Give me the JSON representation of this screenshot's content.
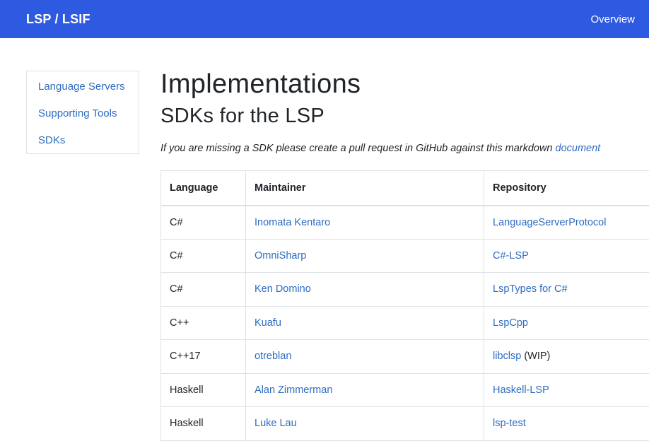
{
  "navbar": {
    "brand": "LSP / LSIF",
    "overview": "Overview"
  },
  "sidebar": {
    "items": [
      {
        "label": "Language Servers"
      },
      {
        "label": "Supporting Tools"
      },
      {
        "label": "SDKs"
      }
    ]
  },
  "main": {
    "title": "Implementations",
    "subtitle": "SDKs for the LSP",
    "note_text": "If you are missing a SDK please create a pull request in GitHub against this markdown ",
    "note_link": "document"
  },
  "table": {
    "headers": [
      "Language",
      "Maintainer",
      "Repository"
    ],
    "rows": [
      {
        "language": "C#",
        "maintainer": "Inomata Kentaro",
        "repository": "LanguageServerProtocol",
        "suffix": ""
      },
      {
        "language": "C#",
        "maintainer": "OmniSharp",
        "repository": "C#-LSP",
        "suffix": ""
      },
      {
        "language": "C#",
        "maintainer": "Ken Domino",
        "repository": "LspTypes for C#",
        "suffix": ""
      },
      {
        "language": "C++",
        "maintainer": "Kuafu",
        "repository": "LspCpp",
        "suffix": ""
      },
      {
        "language": "C++17",
        "maintainer": "otreblan",
        "repository": "libclsp",
        "suffix": " (WIP)"
      },
      {
        "language": "Haskell",
        "maintainer": "Alan Zimmerman",
        "repository": "Haskell-LSP",
        "suffix": ""
      },
      {
        "language": "Haskell",
        "maintainer": "Luke Lau",
        "repository": "lsp-test",
        "suffix": ""
      }
    ]
  }
}
